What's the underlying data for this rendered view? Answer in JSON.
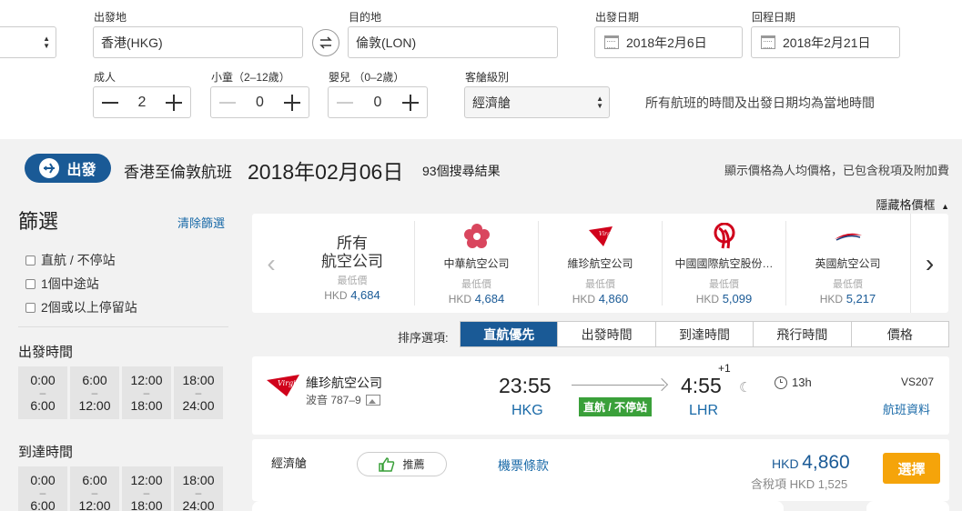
{
  "search": {
    "origin_label": "出發地",
    "origin_value": "香港(HKG)",
    "destination_label": "目的地",
    "destination_value": "倫敦(LON)",
    "depart_label": "出發日期",
    "depart_value": "2018年2月6日",
    "return_label": "回程日期",
    "return_value": "2018年2月21日",
    "adults_label": "成人",
    "adults_value": "2",
    "children_label": "小童（2–12歲）",
    "children_value": "0",
    "infants_label": "嬰兒 （0–2歲）",
    "infants_value": "0",
    "cabin_label": "客艙級別",
    "cabin_value": "經濟艙",
    "local_time_note": "所有航班的時間及出發日期均為當地時間"
  },
  "header": {
    "badge": "出發",
    "route": "香港至倫敦航班",
    "date": "2018年02月06日",
    "results": "93個搜尋結果",
    "price_note": "顯示價格為人均價格，已包含稅項及附加費",
    "hide_grid": "隱藏格價框"
  },
  "filters": {
    "title": "篩選",
    "clear": "清除篩選",
    "stops": [
      "直航 / 不停站",
      "1個中途站",
      "2個或以上停留站"
    ],
    "depart_title": "出發時間",
    "arrive_title": "到達時間",
    "time_slots": [
      {
        "from": "0:00",
        "sep": "–",
        "to": "6:00"
      },
      {
        "from": "6:00",
        "sep": "–",
        "to": "12:00"
      },
      {
        "from": "12:00",
        "sep": "–",
        "to": "18:00"
      },
      {
        "from": "18:00",
        "sep": "–",
        "to": "24:00"
      }
    ]
  },
  "airline_grid": {
    "all_line1": "所有",
    "all_line2": "航空公司",
    "low_label": "最低價",
    "currency": "HKD",
    "airlines": [
      {
        "name": "所有航空公司",
        "price": "4,684"
      },
      {
        "name": "中華航空公司",
        "price": "4,684"
      },
      {
        "name": "維珍航空公司",
        "price": "4,860"
      },
      {
        "name": "中國國際航空股份…",
        "price": "5,099"
      },
      {
        "name": "英國航空公司",
        "price": "5,217"
      }
    ]
  },
  "sort": {
    "label": "排序選項:",
    "tabs": [
      "直航優先",
      "出發時間",
      "到達時間",
      "飛行時間",
      "價格"
    ],
    "active": 0
  },
  "flight": {
    "airline": "維珍航空公司",
    "aircraft": "波音 787–9",
    "depart_time": "23:55",
    "depart_code": "HKG",
    "arrive_time": "4:55",
    "day_offset": "+1",
    "arrive_code": "LHR",
    "nonstop": "直航 / 不停站",
    "duration": "13h",
    "flight_no": "VS207",
    "details": "航班資料"
  },
  "fare": {
    "cabin": "經濟艙",
    "recommend": "推薦",
    "terms": "機票條款",
    "currency": "HKD",
    "price": "4,860",
    "tax_prefix": "含稅項",
    "tax": "HKD 1,525",
    "select": "選擇"
  },
  "colors": {
    "brand_blue": "#1a5a96",
    "select_orange": "#f5a40a",
    "nonstop_green": "#3aa03a"
  }
}
